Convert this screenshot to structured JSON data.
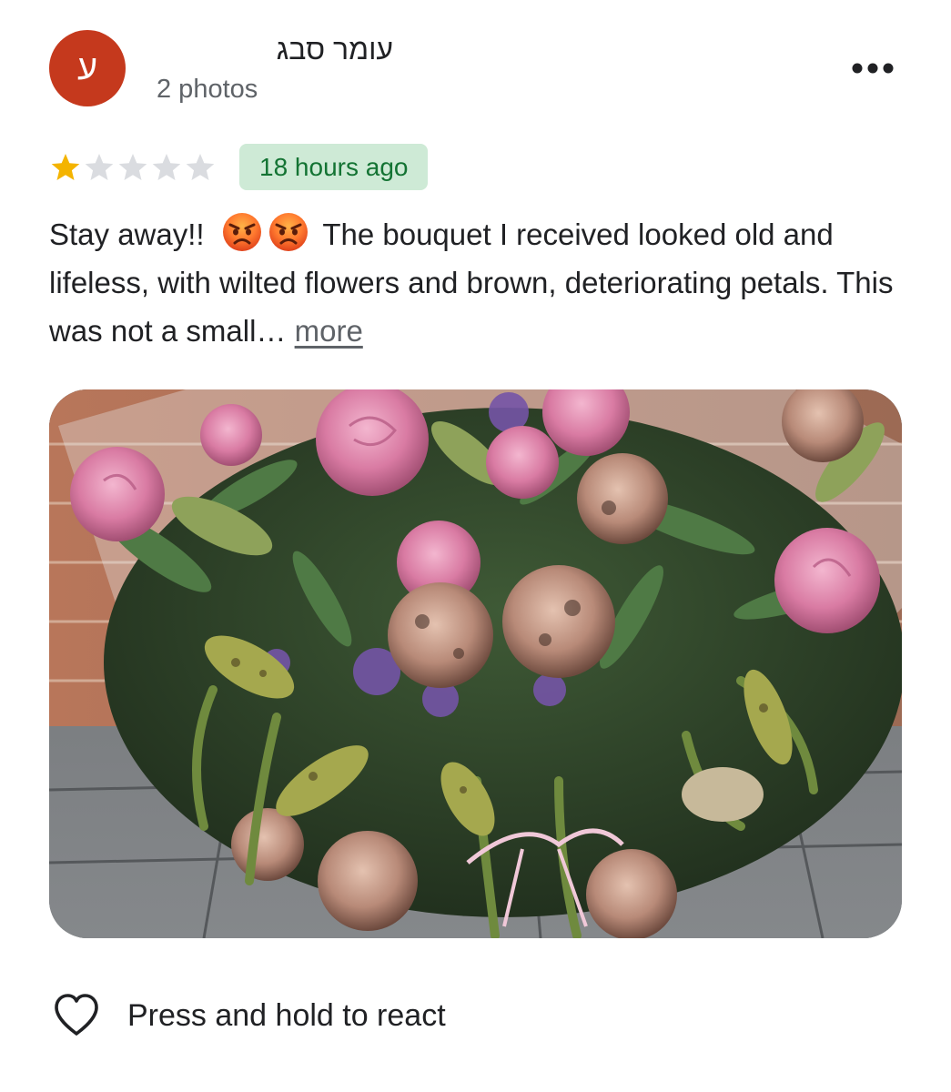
{
  "reviewer": {
    "initial": "ע",
    "name": "עומר סבג",
    "photos": "2 photos",
    "avatar_color": "#c5391d"
  },
  "menu": {
    "icon": "more-horizontal-icon"
  },
  "rating": {
    "value": 1,
    "max": 5,
    "filled_color": "#f4b400",
    "empty_color": "#dadce0"
  },
  "time_badge": {
    "label": "18 hours ago",
    "background": "#ceead6",
    "text_color": "#137333"
  },
  "review": {
    "opening": "Stay away!!",
    "emojis": [
      "angry-face-icon",
      "angry-face-icon"
    ],
    "body": "The bouquet I received looked old and lifeless, with wilted flowers and brown, deteriorating petals. This was not a small…",
    "more_label": "more"
  },
  "photo": {
    "subject": "wilted-bouquet-photo"
  },
  "react": {
    "icon": "heart-outline-icon",
    "label": "Press and hold to react"
  }
}
